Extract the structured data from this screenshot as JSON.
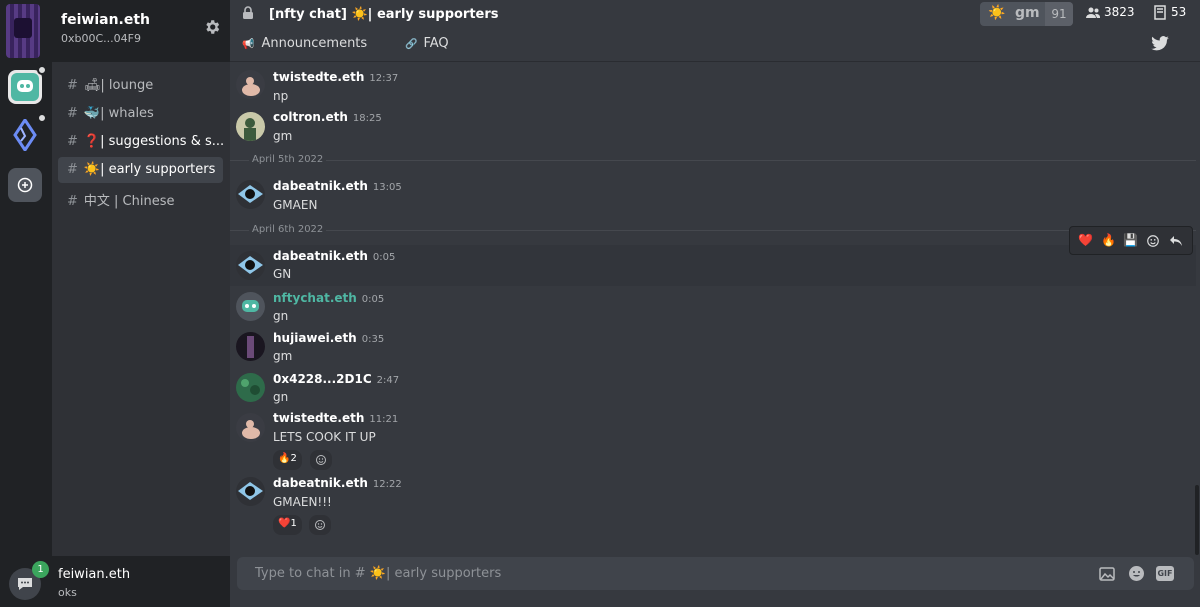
{
  "profile": {
    "name": "feiwian.eth",
    "address": "0xb00C...04F9"
  },
  "channels": [
    {
      "prefix": "#",
      "label": "🛋| lounge"
    },
    {
      "prefix": "#",
      "label": "🐳| whales"
    },
    {
      "prefix": "#",
      "label": "❓| suggestions & s..."
    },
    {
      "prefix": "#",
      "label": "☀️| early supporters"
    },
    {
      "prefix": "#",
      "label": "中文 | Chinese"
    }
  ],
  "user_panel": {
    "name": "feiwian.eth",
    "status": "oks",
    "badge": "1"
  },
  "header": {
    "title": "[nfty chat] ☀️| early supporters",
    "gm_label": "gm",
    "gm_sun": "☀️",
    "gm_count": "91",
    "members": "3823",
    "holders": "53",
    "tabs": [
      {
        "icon": "📢",
        "label": "Announcements"
      },
      {
        "icon": "🔗",
        "label": "FAQ"
      }
    ]
  },
  "messages": [
    {
      "author": "twistedte.eth",
      "time": "12:37",
      "text": "np"
    },
    {
      "author": "coltron.eth",
      "time": "18:25",
      "text": "gm"
    },
    {
      "divider": "April 5th 2022"
    },
    {
      "author": "dabeatnik.eth",
      "time": "13:05",
      "text": "GMAEN"
    },
    {
      "divider": "April 6th 2022"
    },
    {
      "author": "dabeatnik.eth",
      "time": "0:05",
      "text": "GN"
    },
    {
      "author": "nftychat.eth",
      "time": "0:05",
      "text": "gn"
    },
    {
      "author": "hujiawei.eth",
      "time": "0:35",
      "text": "gm"
    },
    {
      "author": "0x4228...2D1C",
      "time": "2:47",
      "text": "gn"
    },
    {
      "author": "twistedte.eth",
      "time": "11:21",
      "text": "LETS COOK IT UP",
      "reaction": "🔥2"
    },
    {
      "author": "dabeatnik.eth",
      "time": "12:22",
      "text": "GMAEN!!!",
      "reaction": "❤️1"
    }
  ],
  "toolbar": {
    "heart": "❤️",
    "fire": "🔥",
    "save": "💾"
  },
  "composer": {
    "placeholder": "Type to chat in # ☀️| early supporters",
    "gif_label": "GIF"
  },
  "colors": {
    "accent": "#4fb7a3",
    "background": "#36393f",
    "sidebar": "#2f3136",
    "rail": "#202225"
  }
}
